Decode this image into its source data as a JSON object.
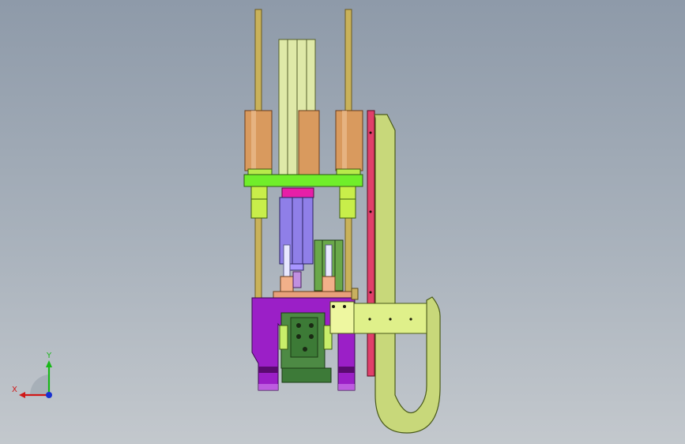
{
  "view": {
    "background_top": "#8e9aa9",
    "background_bottom": "#c3c8cd"
  },
  "triad": {
    "x_label": "X",
    "y_label": "Y",
    "x_color": "#d01818",
    "y_color": "#18b818",
    "z_color": "#1830d0"
  },
  "palette": {
    "guide_rod": "#c9b25a",
    "bushing": "#d99a5e",
    "mount_plate": "#70ee2a",
    "cylinder": "#8f7fe8",
    "magenta_block": "#e61fa8",
    "base_frame": "#9b1fc7",
    "clamp_block": "#4d8a44",
    "arm": "#dff08a",
    "red_rail": "#e0406a",
    "light_green": "#c8ee6a"
  }
}
